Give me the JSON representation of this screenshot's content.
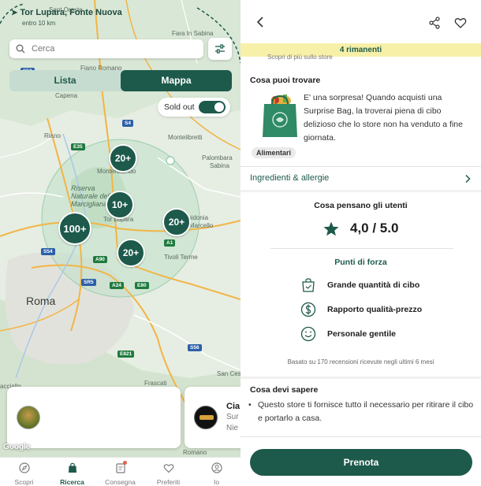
{
  "map_screen": {
    "location": {
      "title": "Tor Lupara, Fonte Nuova",
      "subtitle": "entro 10 km"
    },
    "search": {
      "placeholder": "Cerca"
    },
    "view_toggle": {
      "lista": "Lista",
      "mappa": "Mappa",
      "selected": "Mappa"
    },
    "sold_out": {
      "label": "Sold out",
      "enabled": true
    },
    "map_labels": {
      "orte": "Sant Oreste",
      "fara": "Fara In Sabina",
      "fiano": "Fiano Romano",
      "capena": "Capena",
      "riano": "Riano",
      "montelibretti": "Montelibretti",
      "palombara": "Palombara",
      "sabina": "Sabina",
      "monterotondo": "Monterotondo",
      "reserve": "Riserva\nNaturale della\nMarcigliana",
      "torlupara": "Tor Lupara",
      "guidonia": "Guidonia",
      "marcello": "Marcello",
      "tivoli": "Tivoli Terme",
      "roma": "Roma",
      "frascati": "Frascati",
      "romano": "Romano",
      "sancesareo": "San Ces",
      "acciallo": "acciallo"
    },
    "highways": [
      "E35",
      "S4",
      "S53",
      "S54",
      "A1",
      "A90",
      "SR5",
      "A24",
      "E80",
      "E821",
      "S56",
      "S3"
    ],
    "clusters": [
      "20+",
      "10+",
      "100+",
      "20+",
      "20+"
    ],
    "cards": [
      {
        "name": "",
        "line1": "",
        "line2": ""
      },
      {
        "name": "Cia",
        "line1": "Sur",
        "line2": "Nie"
      }
    ],
    "google": "Google",
    "tabs": [
      "Scopri",
      "Ricerca",
      "Consegna",
      "Preferiti",
      "Io"
    ],
    "active_tab": "Ricerca",
    "colors": {
      "brand": "#1d5a4b",
      "notification": "#e0624a"
    }
  },
  "detail_screen": {
    "banner": "4 rimanenti",
    "sub_banner": "Scopri di più sullo store",
    "what_title": "Cosa puoi trovare",
    "what_desc": "E' una sorpresa! Quando acquisti una Surprise Bag, la troverai piena di cibo delizioso che lo store non ha venduto a fine giornata.",
    "chip": "Alimentari",
    "ingredients": "Ingredienti & allergie",
    "reviews_title": "Cosa pensano gli utenti",
    "rating": "4,0 / 5.0",
    "strengths_title": "Punti di forza",
    "strengths": [
      "Grande quantità di cibo",
      "Rapporto qualità-prezzo",
      "Personale gentile"
    ],
    "based_on": "Basato su 170 recensioni ricevute negli ultimi 6 mesi",
    "know_title": "Cosa devi sapere",
    "know_text": "Questo store ti fornisce tutto il necessario per ritirare il cibo e portarlo a casa.",
    "cta": "Prenota",
    "colors": {
      "brand": "#1d5a4b",
      "banner": "#f7f0a8"
    }
  }
}
